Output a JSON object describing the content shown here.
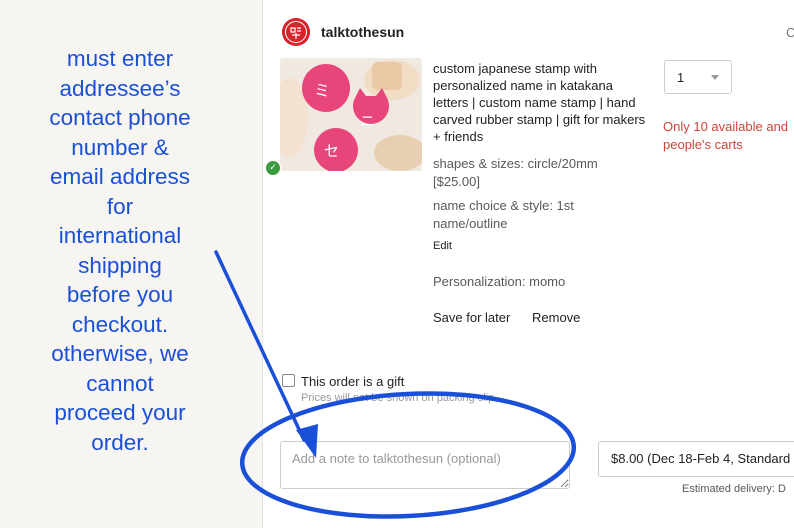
{
  "annotation": {
    "lines": [
      "must enter",
      "addressee’s",
      "contact phone",
      "number &",
      "email address",
      "for",
      "international",
      "shipping",
      "before you",
      "checkout.",
      "otherwise, we",
      "cannot",
      "proceed your",
      "order."
    ],
    "color": "#1a4fd8"
  },
  "shop": {
    "name": "talktothesun",
    "edge_letter": "C"
  },
  "item": {
    "title": "custom japanese stamp with personalized name in katakana letters | custom name stamp | hand carved rubber stamp | gift for makers + friends",
    "variations": [
      "shapes & sizes: circle/20mm [$25.00]",
      "name choice & style: 1st name/outline"
    ],
    "edit_label": "Edit",
    "personalization": "Personalization: momo",
    "save_for_later": "Save for later",
    "remove": "Remove",
    "quantity": "1",
    "stock_message_line1": "Only 10 available and",
    "stock_message_line2": "people's carts"
  },
  "gift": {
    "label": "This order is a gift",
    "hint": "Prices will not be shown on packing slip"
  },
  "note": {
    "placeholder": "Add a note to talktothesun (optional)"
  },
  "shipping": {
    "selected": "$8.00 (Dec 18-Feb 4, Standard",
    "estimated_delivery": "Estimated delivery: D"
  },
  "icons": {
    "shop_logo": "shop-logo-icon",
    "check": "check-circle-icon",
    "dropdown": "chevron-down-icon",
    "arrow": "arrow-annotation",
    "ellipse": "ellipse-highlight-annotation"
  },
  "colors": {
    "accent_red": "#d0433b",
    "annotation_blue": "#1a4fd8",
    "success_green": "#3a9a3f"
  }
}
